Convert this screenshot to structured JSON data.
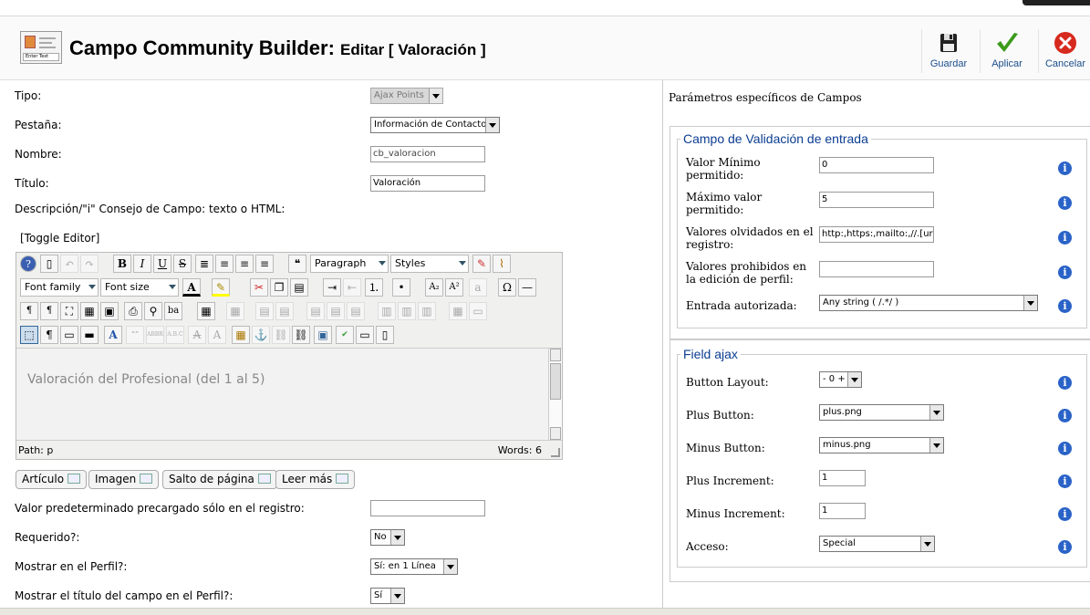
{
  "header": {
    "icon_caption": "Enter Text",
    "title_main": "Campo Community Builder:",
    "title_sub": "Editar [ Valoración ]",
    "buttons": [
      {
        "label": "Guardar",
        "icon": "save-disk-icon"
      },
      {
        "label": "Aplicar",
        "icon": "checkmark-icon"
      },
      {
        "label": "Cancelar",
        "icon": "cancel-icon"
      }
    ]
  },
  "left": {
    "tipo": {
      "label": "Tipo:",
      "value": "Ajax Points"
    },
    "pestana": {
      "label": "Pestaña:",
      "value": "Información de Contacto"
    },
    "nombre": {
      "label": "Nombre:",
      "value": "cb_valoracion"
    },
    "titulo": {
      "label": "Título:",
      "value": "Valoración"
    },
    "descripcion_label": "Descripción/\"i\" Consejo de Campo: texto o HTML:",
    "toggle_editor": "[Toggle Editor]",
    "editor": {
      "paragraph": "Paragraph",
      "styles": "Styles",
      "font_family": "Font family",
      "font_size": "Font size",
      "content": "Valoración del Profesional (del 1 al 5)",
      "path": "Path:  p",
      "words": "Words: 6"
    },
    "editor_buttons": [
      "Artículo",
      "Imagen",
      "Salto de página",
      "Leer más"
    ],
    "valor_predeterminado": {
      "label": "Valor predeterminado precargado sólo en el registro:",
      "value": ""
    },
    "requerido": {
      "label": "Requerido?:",
      "value": "No"
    },
    "mostrar_perfil": {
      "label": "Mostrar en el Perfil?:",
      "value": "Sí: en 1 Línea"
    },
    "mostrar_titulo": {
      "label": "Mostrar el título del campo en el Perfil?:",
      "value": "Sí"
    }
  },
  "right": {
    "title": "Parámetros específicos de Campos",
    "validation": {
      "legend": "Campo de Validación de entrada",
      "min": {
        "label": "Valor Mínimo permitido:",
        "value": "0"
      },
      "max": {
        "label": "Máximo valor permitido:",
        "value": "5"
      },
      "olvidados": {
        "label": "Valores olvidados en el registro:",
        "value": "http:,https:,mailto:,//.[url],<a"
      },
      "prohibidos": {
        "label": "Valores prohibidos en la edición de perfil:",
        "value": ""
      },
      "entrada": {
        "label": "Entrada autorizada:",
        "value": "Any string ( /.*/ )"
      }
    },
    "ajax": {
      "legend": "Field ajax",
      "layout": {
        "label": "Button Layout:",
        "value": "- 0 +"
      },
      "plus": {
        "label": "Plus Button:",
        "value": "plus.png"
      },
      "minus": {
        "label": "Minus Button:",
        "value": "minus.png"
      },
      "plus_inc": {
        "label": "Plus Increment:",
        "value": "1"
      },
      "minus_inc": {
        "label": "Minus Increment:",
        "value": "1"
      },
      "acceso": {
        "label": "Acceso:",
        "value": "Special"
      }
    },
    "info_glyph": "i"
  }
}
